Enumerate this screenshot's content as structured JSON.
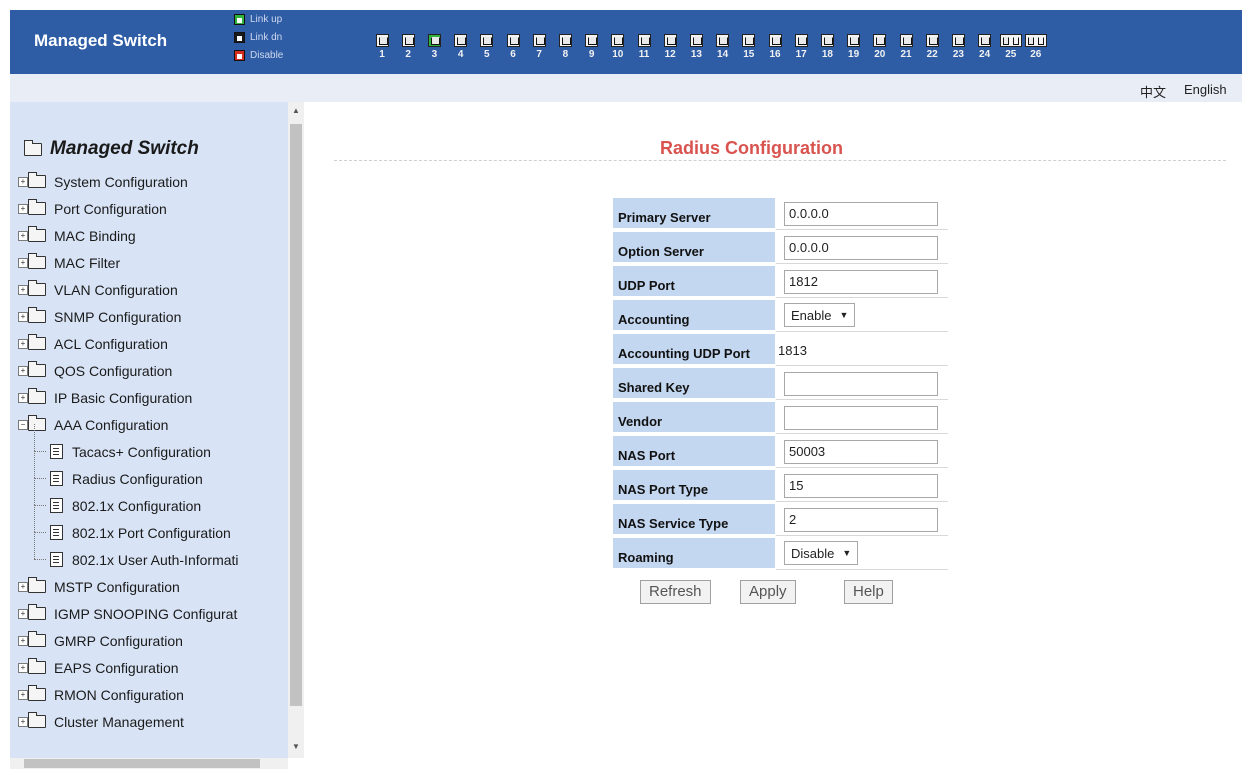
{
  "header": {
    "title": "Managed Switch",
    "legend": [
      {
        "label": "Link up",
        "color": "#2fb33a"
      },
      {
        "label": "Link dn",
        "color": "#1a1a1a"
      },
      {
        "label": "Disable",
        "color": "#d62d20"
      }
    ],
    "ports": [
      {
        "num": "1",
        "status": "link-dn",
        "type": "rj45"
      },
      {
        "num": "2",
        "status": "link-dn",
        "type": "rj45"
      },
      {
        "num": "3",
        "status": "link-up",
        "type": "rj45"
      },
      {
        "num": "4",
        "status": "link-dn",
        "type": "rj45"
      },
      {
        "num": "5",
        "status": "link-dn",
        "type": "rj45"
      },
      {
        "num": "6",
        "status": "link-dn",
        "type": "rj45"
      },
      {
        "num": "7",
        "status": "link-dn",
        "type": "rj45"
      },
      {
        "num": "8",
        "status": "link-dn",
        "type": "rj45"
      },
      {
        "num": "9",
        "status": "link-dn",
        "type": "rj45"
      },
      {
        "num": "10",
        "status": "link-dn",
        "type": "rj45"
      },
      {
        "num": "11",
        "status": "link-dn",
        "type": "rj45"
      },
      {
        "num": "12",
        "status": "link-dn",
        "type": "rj45"
      },
      {
        "num": "13",
        "status": "link-dn",
        "type": "rj45"
      },
      {
        "num": "14",
        "status": "link-dn",
        "type": "rj45"
      },
      {
        "num": "15",
        "status": "link-dn",
        "type": "rj45"
      },
      {
        "num": "16",
        "status": "link-dn",
        "type": "rj45"
      },
      {
        "num": "17",
        "status": "link-dn",
        "type": "rj45"
      },
      {
        "num": "18",
        "status": "link-dn",
        "type": "rj45"
      },
      {
        "num": "19",
        "status": "link-dn",
        "type": "rj45"
      },
      {
        "num": "20",
        "status": "link-dn",
        "type": "rj45"
      },
      {
        "num": "21",
        "status": "link-dn",
        "type": "rj45"
      },
      {
        "num": "22",
        "status": "link-dn",
        "type": "rj45"
      },
      {
        "num": "23",
        "status": "link-dn",
        "type": "rj45"
      },
      {
        "num": "24",
        "status": "link-dn",
        "type": "rj45"
      },
      {
        "num": "25",
        "status": "link-dn",
        "type": "sfp"
      },
      {
        "num": "26",
        "status": "link-dn",
        "type": "sfp"
      }
    ]
  },
  "lang": {
    "zh": "中文",
    "en": "English"
  },
  "sidebar": {
    "root": "Managed Switch",
    "items": [
      {
        "label": "System Configuration",
        "expanded": false
      },
      {
        "label": "Port Configuration",
        "expanded": false
      },
      {
        "label": "MAC Binding",
        "expanded": false
      },
      {
        "label": "MAC Filter",
        "expanded": false
      },
      {
        "label": "VLAN Configuration",
        "expanded": false
      },
      {
        "label": "SNMP Configuration",
        "expanded": false
      },
      {
        "label": "ACL Configuration",
        "expanded": false
      },
      {
        "label": "QOS Configuration",
        "expanded": false
      },
      {
        "label": "IP Basic Configuration",
        "expanded": false
      },
      {
        "label": "AAA Configuration",
        "expanded": true,
        "children": [
          "Tacacs+ Configuration",
          "Radius Configuration",
          "802.1x Configuration",
          "802.1x Port Configuration",
          "802.1x User Auth-Informati"
        ]
      },
      {
        "label": "MSTP Configuration",
        "expanded": false
      },
      {
        "label": "IGMP SNOOPING Configurat",
        "expanded": false
      },
      {
        "label": "GMRP Configuration",
        "expanded": false
      },
      {
        "label": "EAPS Configuration",
        "expanded": false
      },
      {
        "label": "RMON Configuration",
        "expanded": false
      },
      {
        "label": "Cluster Management",
        "expanded": false
      }
    ]
  },
  "main": {
    "title": "Radius Configuration",
    "fields": [
      {
        "label": "Primary Server",
        "value": "0.0.0.0",
        "kind": "input"
      },
      {
        "label": "Option Server",
        "value": "0.0.0.0",
        "kind": "input"
      },
      {
        "label": "UDP Port",
        "value": "1812",
        "kind": "input"
      },
      {
        "label": "Accounting",
        "value": "Enable",
        "kind": "select"
      },
      {
        "label": "Accounting UDP Port",
        "value": "1813",
        "kind": "plain"
      },
      {
        "label": "Shared Key",
        "value": "",
        "kind": "input"
      },
      {
        "label": "Vendor",
        "value": "",
        "kind": "input"
      },
      {
        "label": "NAS Port",
        "value": "50003",
        "kind": "input"
      },
      {
        "label": "NAS Port Type",
        "value": "15",
        "kind": "input"
      },
      {
        "label": "NAS Service Type",
        "value": "2",
        "kind": "input"
      },
      {
        "label": "Roaming",
        "value": "Disable",
        "kind": "select"
      }
    ],
    "buttons": {
      "refresh": "Refresh",
      "apply": "Apply",
      "help": "Help"
    }
  }
}
